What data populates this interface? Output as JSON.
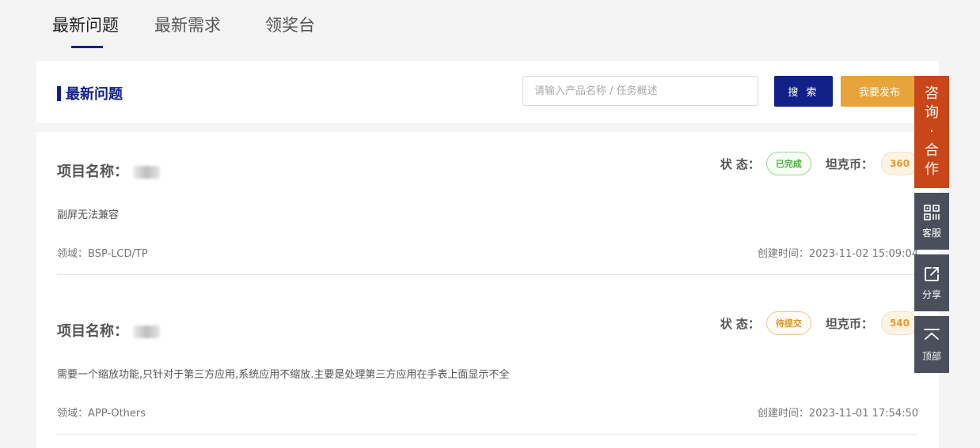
{
  "tabs": [
    {
      "label": "最新问题",
      "active": true
    },
    {
      "label": "最新需求",
      "active": false
    },
    {
      "label": "领奖台",
      "active": false
    }
  ],
  "header": {
    "title": "最新问题",
    "search_placeholder": "请输入产品名称 / 任务概述",
    "search_button": "搜 索",
    "publish_button": "我要发布"
  },
  "items": [
    {
      "project_label": "项目名称：",
      "status_label": "状 态：",
      "status": "已完成",
      "coin_label": "坦克币：",
      "coins": "360",
      "description": "副屏无法兼容",
      "field": "领域：BSP-LCD/TP",
      "created": "创建时间：2023-11-02 15:09:04"
    },
    {
      "project_label": "项目名称：",
      "status_label": "状 态：",
      "status": "待提交",
      "coin_label": "坦克币：",
      "coins": "540",
      "description": "需要一个缩放功能,只针对于第三方应用,系统应用不缩放.主要是处理第三方应用在手表上面显示不全",
      "field": "领域：APP-Others",
      "created": "创建时间：2023-11-01 17:54:50"
    }
  ],
  "sidebar": {
    "consult_chars": [
      "咨",
      "询",
      "·",
      "合",
      "作"
    ],
    "service": "客服",
    "share": "分享",
    "top": "顶部"
  },
  "colors": {
    "brand_blue": "#12208a",
    "publish_orange": "#e8a33a",
    "consult_red": "#c9461b",
    "sidebar_gray": "#4b4f5c",
    "done_green": "#4cae3a",
    "pending_orange": "#d9962c"
  }
}
